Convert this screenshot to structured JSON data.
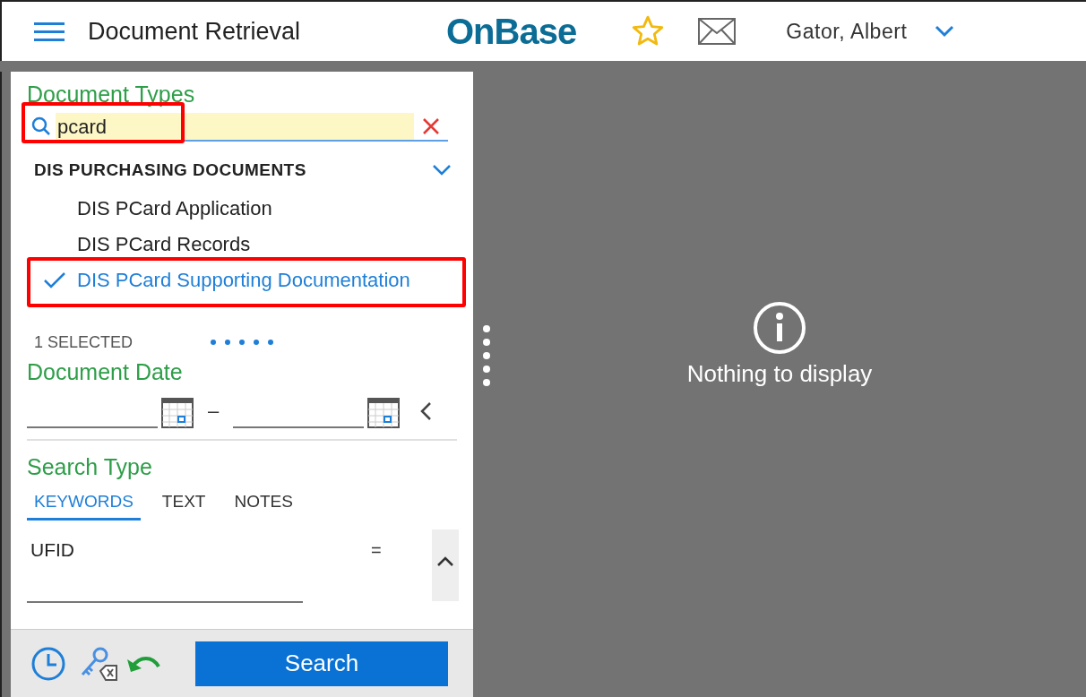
{
  "header": {
    "title": "Document Retrieval",
    "logo": "OnBase",
    "user": "Gator, Albert"
  },
  "document_types": {
    "heading": "Document Types",
    "search": {
      "value": "pcard",
      "highlighted": true
    },
    "group": {
      "label": "DIS PURCHASING DOCUMENTS",
      "expanded": true,
      "items": [
        {
          "label": "DIS PCard Application",
          "selected": false,
          "highlighted": false
        },
        {
          "label": "DIS PCard Records",
          "selected": false,
          "highlighted": false
        },
        {
          "label": "DIS PCard Supporting Documentation",
          "selected": true,
          "highlighted": true
        }
      ]
    },
    "selected_count": "1 SELECTED"
  },
  "document_date": {
    "heading": "Document Date",
    "separator": "–"
  },
  "search_type": {
    "heading": "Search Type",
    "tabs": [
      {
        "label": "KEYWORDS",
        "selected": true
      },
      {
        "label": "TEXT",
        "selected": false
      },
      {
        "label": "NOTES",
        "selected": false
      }
    ],
    "keywords": [
      {
        "label": "UFID",
        "operator": "="
      }
    ]
  },
  "footer": {
    "search_button": "Search"
  },
  "viewer": {
    "message": "Nothing to display"
  }
}
